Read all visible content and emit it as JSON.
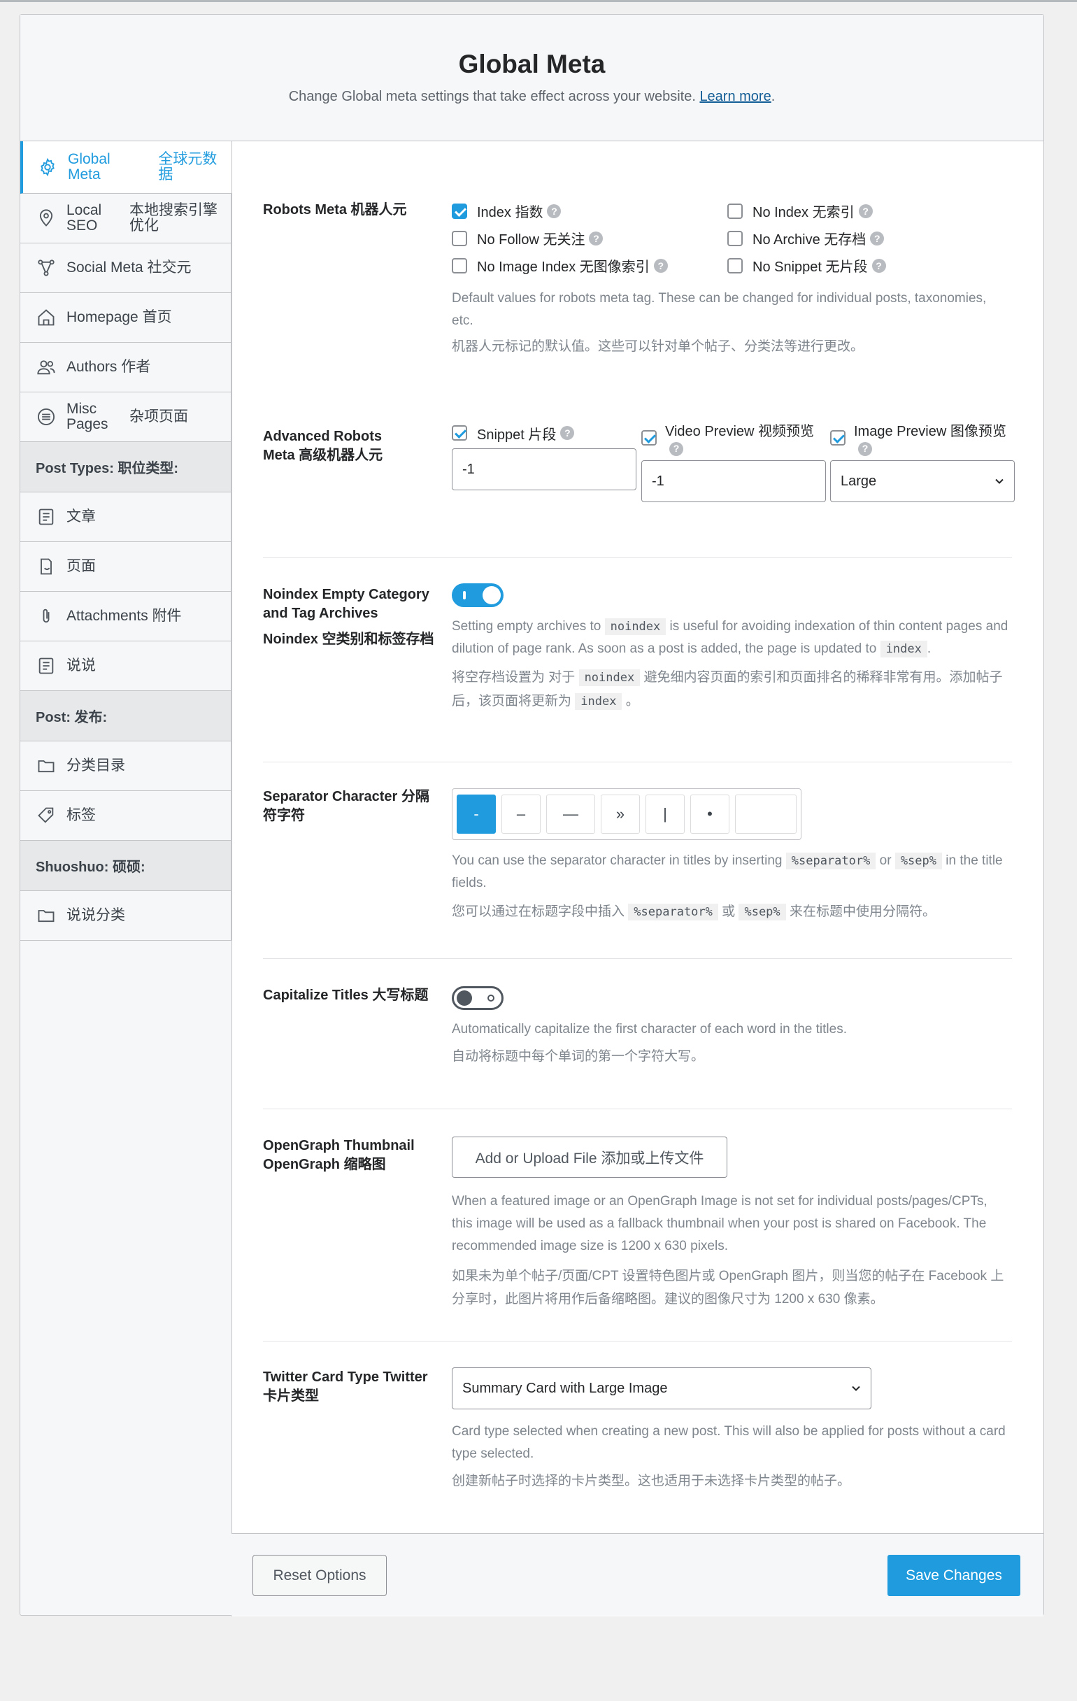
{
  "header": {
    "title": "Global Meta",
    "subtitle": "Change Global meta settings that take effect across your website.",
    "learn_more": "Learn more",
    "period": "."
  },
  "sidebar": {
    "items": [
      {
        "label_a": "Global Meta",
        "label_b": "全球元数据",
        "icon": "gear-icon"
      },
      {
        "label_a": "Local SEO",
        "label_b": "本地搜索引擎优化",
        "icon": "location-pin-icon"
      },
      {
        "label": "Social Meta  社交元",
        "icon": "share-nodes-icon"
      },
      {
        "label": "Homepage  首页",
        "icon": "home-icon"
      },
      {
        "label": "Authors  作者",
        "icon": "users-icon"
      },
      {
        "label_a": "Misc Pages",
        "label_b": "杂项页面",
        "icon": "list-circle-icon"
      }
    ],
    "section_post_types": "Post Types:  职位类型:",
    "post_types": [
      {
        "label": "文章",
        "icon": "document-icon"
      },
      {
        "label": "页面",
        "icon": "page-icon"
      },
      {
        "label": "Attachments  附件",
        "icon": "paperclip-icon"
      },
      {
        "label": "说说",
        "icon": "document-icon"
      }
    ],
    "section_post": "Post:  发布:",
    "post": [
      {
        "label": "分类目录",
        "icon": "folder-icon"
      },
      {
        "label": "标签",
        "icon": "tag-icon"
      }
    ],
    "section_shuoshuo": "Shuoshuo:  硕硕:",
    "shuoshuo": [
      {
        "label": "说说分类",
        "icon": "folder-icon"
      }
    ]
  },
  "robots": {
    "label": "Robots Meta  机器人元",
    "options": [
      {
        "label": "Index  指数",
        "checked": true
      },
      {
        "label": "No Index  无索引",
        "checked": false
      },
      {
        "label": "No Follow  无关注",
        "checked": false
      },
      {
        "label": "No Archive  无存档",
        "checked": false
      },
      {
        "label": "No Image Index  无图像索引",
        "checked": false
      },
      {
        "label": "No Snippet  无片段",
        "checked": false
      }
    ],
    "desc": "Default values for robots meta tag. These can be changed for individual posts, taxonomies, etc.",
    "desc_cn": "机器人元标记的默认值。这些可以针对单个帖子、分类法等进行更改。"
  },
  "advanced": {
    "label": "Advanced Robots Meta  高级机器人元",
    "snippet_label": "Snippet  片段",
    "snippet_value": "-1",
    "video_label": "Video Preview  视频预览",
    "video_value": "-1",
    "image_label": "Image Preview  图像预览",
    "image_value": "Large"
  },
  "noindex": {
    "label": "Noindex Empty Category and Tag Archives",
    "label_cn": "Noindex 空类别和标签存档",
    "enabled": true,
    "desc_1": "Setting empty archives to",
    "code_1": "noindex",
    "desc_2": "is useful for avoiding indexation of thin content pages and dilution of page rank. As soon as a post is added, the page is updated to",
    "code_2": "index",
    "desc_3": ".",
    "cn_1": "将空存档设置为 对于",
    "cn_code_1": "noindex",
    "cn_2": "避免细内容页面的索引和页面排名的稀释非常有用。添加帖子后，该页面将更新为",
    "cn_code_2": "index",
    "cn_3": "。"
  },
  "separator": {
    "label": "Separator Character  分隔符字符",
    "options": [
      "-",
      "–",
      "—",
      "»",
      "|",
      "•",
      ""
    ],
    "selected": "-",
    "desc_1": "You can use the separator character in titles by inserting",
    "code_1": "%separator%",
    "desc_or": "or",
    "code_2": "%sep%",
    "desc_2": "in the title fields.",
    "cn_1": "您可以通过在标题字段中插入",
    "cn_code_1": "%separator%",
    "cn_or": "或",
    "cn_code_2": "%sep%",
    "cn_2": "来在标题中使用分隔符。"
  },
  "capitalize": {
    "label": "Capitalize Titles  大写标题",
    "enabled": false,
    "desc": "Automatically capitalize the first character of each word in the titles.",
    "desc_cn": "自动将标题中每个单词的第一个字符大写。"
  },
  "opengraph": {
    "label": "OpenGraph Thumbnail  OpenGraph 缩略图",
    "button": "Add or Upload File  添加或上传文件",
    "desc": "When a featured image or an OpenGraph Image is not set for individual posts/pages/CPTs, this image will be used as a fallback thumbnail when your post is shared on Facebook. The recommended image size is 1200 x 630 pixels.",
    "desc_cn": "如果未为单个帖子/页面/CPT 设置特色图片或 OpenGraph 图片，则当您的帖子在 Facebook 上分享时，此图片将用作后备缩略图。建议的图像尺寸为 1200 x 630 像素。"
  },
  "twitter": {
    "label": "Twitter Card Type  Twitter 卡片类型",
    "value": "Summary Card with Large Image",
    "desc": "Card type selected when creating a new post. This will also be applied for posts without a card type selected.",
    "desc_cn": "创建新帖子时选择的卡片类型。这也适用于未选择卡片类型的帖子。"
  },
  "footer": {
    "reset": "Reset Options",
    "save": "Save Changes"
  },
  "colors": {
    "accent": "#1f9bde",
    "sidebar_bg": "#f6f7f8",
    "section_bg": "#e7e8e9",
    "muted_text": "#7f868d"
  }
}
